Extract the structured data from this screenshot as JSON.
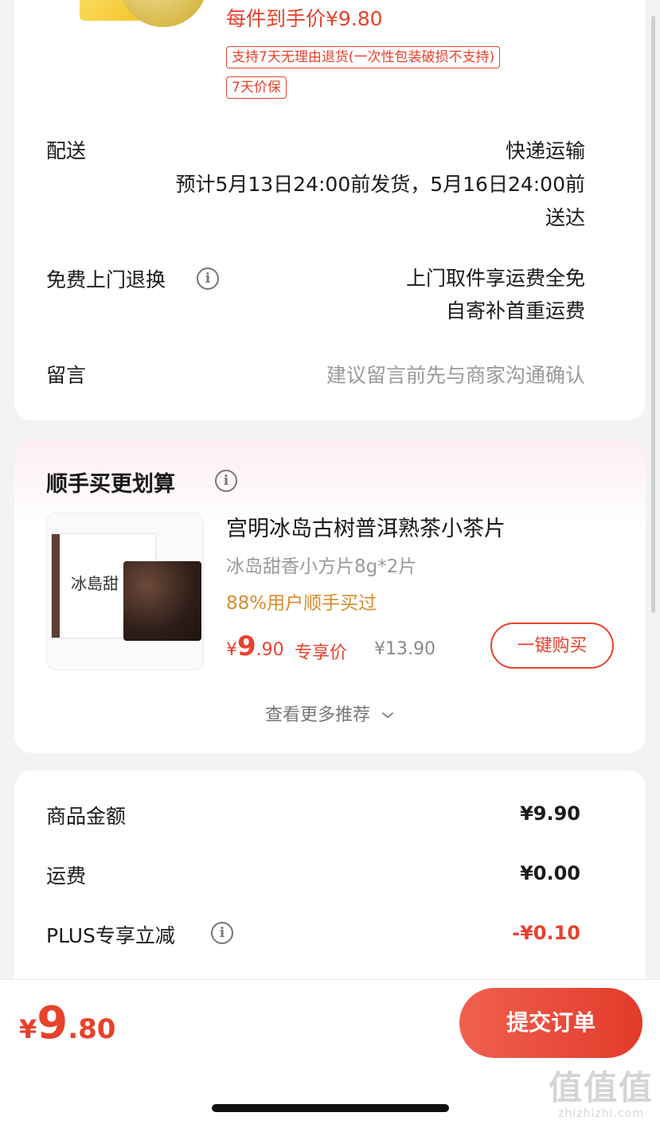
{
  "order_card": {
    "price_label": "每件到手价¥9.80",
    "badge_return": "支持7天无理由退货(一次性包装破损不支持)",
    "badge_price": "7天价保",
    "delivery": {
      "label": "配送",
      "method": "快递运输",
      "estimate_line1": "预计5月13日24:00前发货，5月16日24:00前",
      "estimate_line2": "送达"
    },
    "free_return": {
      "label": "免费上门退换",
      "info_icon": "info-icon",
      "line1": "上门取件享运费全免",
      "line2": "自寄补首重运费"
    },
    "message": {
      "label": "留言",
      "placeholder": "建议留言前先与商家沟通确认"
    }
  },
  "recommend": {
    "title": "顺手买更划算",
    "info_icon": "info-icon",
    "product": {
      "box_text": "冰島甜",
      "title": "宫明冰岛古树普洱熟茶小茶片",
      "spec": "冰岛甜香小方片8g*2片",
      "social": "88%用户顺手买过",
      "price_symbol": "¥",
      "price_int": "9",
      "price_dec": ".90",
      "price_tag": "专享价",
      "original_price": "¥13.90",
      "buy_label": "一键购买"
    },
    "more_label": "查看更多推荐",
    "more_icon": "chevron-down-icon"
  },
  "summary": {
    "rows": [
      {
        "label": "商品金额",
        "value": "¥9.90",
        "accent": false
      },
      {
        "label": "运费",
        "value": "¥0.00",
        "accent": false
      },
      {
        "label": "PLUS专享立减",
        "value": "-¥0.10",
        "accent": true
      }
    ]
  },
  "bottom_bar": {
    "total_symbol": "¥",
    "total_int": "9",
    "total_dec": ".80",
    "submit_label": "提交订单"
  },
  "watermark": {
    "big": "值值值",
    "small": "zhizhizhi.com"
  },
  "colors": {
    "accent": "#e8412c",
    "social": "#d88b2c"
  }
}
